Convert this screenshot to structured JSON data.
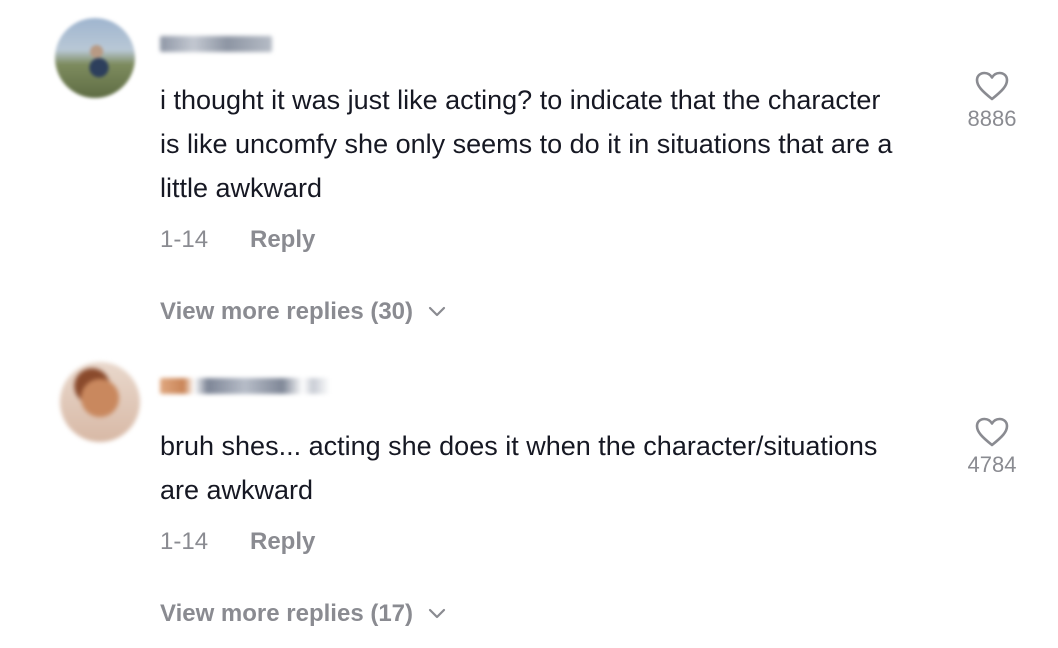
{
  "comments": [
    {
      "text": "i thought it was just like acting? to indicate that the character is like uncomfy she only seems to do it in situations that are a little awkward",
      "date": "1-14",
      "reply_label": "Reply",
      "likes": "8886",
      "view_more": "View more replies (30)"
    },
    {
      "text": "bruh shes... acting she does it when the character/situations are awkward",
      "date": "1-14",
      "reply_label": "Reply",
      "likes": "4784",
      "view_more": "View more replies (17)"
    }
  ],
  "icons": {
    "like": "heart-outline-icon",
    "expand": "chevron-down-icon"
  },
  "colors": {
    "text": "#161823",
    "secondary": "#8a8b91",
    "background": "#ffffff"
  }
}
